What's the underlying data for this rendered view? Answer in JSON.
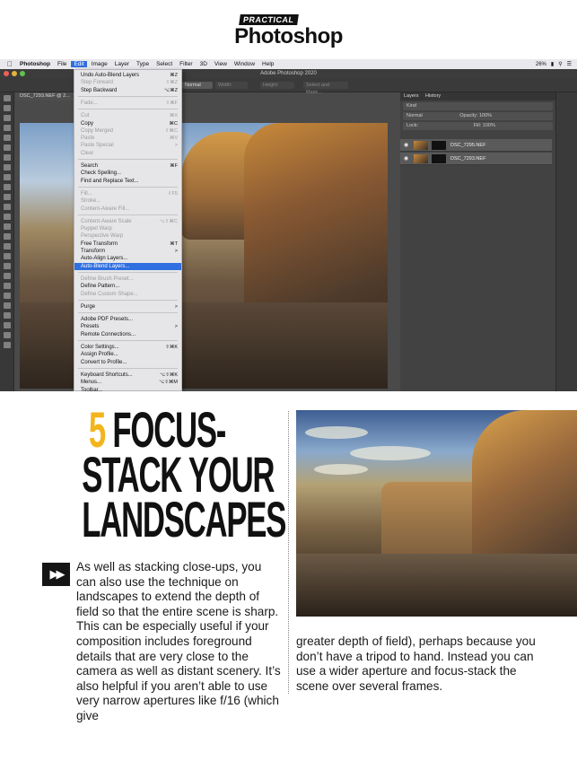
{
  "masthead": {
    "practical": "PRACTICAL",
    "photoshop": "Photoshop"
  },
  "screenshot": {
    "mac_menu": [
      "Photoshop",
      "File",
      "Edit",
      "Image",
      "Layer",
      "Type",
      "Select",
      "Filter",
      "3D",
      "View",
      "Window",
      "Help"
    ],
    "active_menu": "Edit",
    "battery": "26%",
    "window_title": "Adobe Photoshop 2020",
    "doc_tab": "DSC_7293.NEF @ 2...",
    "options": {
      "blend": "Normal",
      "width": "Width:",
      "height": "Height:",
      "select_mask": "Select and Mask..."
    },
    "edit_menu": [
      {
        "label": "Undo Auto-Blend Layers",
        "shortcut": "⌘Z",
        "disabled": false
      },
      {
        "label": "Step Forward",
        "shortcut": "⇧⌘Z",
        "disabled": true
      },
      {
        "label": "Step Backward",
        "shortcut": "⌥⌘Z",
        "disabled": false
      },
      {
        "label": "Fade...",
        "shortcut": "⇧⌘F",
        "disabled": true
      },
      {
        "label": "Cut",
        "shortcut": "⌘X",
        "disabled": true
      },
      {
        "label": "Copy",
        "shortcut": "⌘C",
        "disabled": false
      },
      {
        "label": "Copy Merged",
        "shortcut": "⇧⌘C",
        "disabled": true
      },
      {
        "label": "Paste",
        "shortcut": "⌘V",
        "disabled": true
      },
      {
        "label": "Paste Special",
        "shortcut": ">",
        "disabled": true
      },
      {
        "label": "Clear",
        "shortcut": "",
        "disabled": true
      },
      {
        "label": "Search",
        "shortcut": "⌘F",
        "disabled": false
      },
      {
        "label": "Check Spelling...",
        "shortcut": "",
        "disabled": false
      },
      {
        "label": "Find and Replace Text...",
        "shortcut": "",
        "disabled": false
      },
      {
        "label": "Fill...",
        "shortcut": "⇧F5",
        "disabled": true
      },
      {
        "label": "Stroke...",
        "shortcut": "",
        "disabled": true
      },
      {
        "label": "Content-Aware Fill...",
        "shortcut": "",
        "disabled": true
      },
      {
        "label": "Content-Aware Scale",
        "shortcut": "⌥⇧⌘C",
        "disabled": true
      },
      {
        "label": "Puppet Warp",
        "shortcut": "",
        "disabled": true
      },
      {
        "label": "Perspective Warp",
        "shortcut": "",
        "disabled": true
      },
      {
        "label": "Free Transform",
        "shortcut": "⌘T",
        "disabled": false
      },
      {
        "label": "Transform",
        "shortcut": ">",
        "disabled": false
      },
      {
        "label": "Auto-Align Layers...",
        "shortcut": "",
        "disabled": false
      },
      {
        "label": "Auto-Blend Layers...",
        "shortcut": "",
        "disabled": false,
        "highlighted": true
      },
      {
        "label": "Define Brush Preset...",
        "shortcut": "",
        "disabled": true
      },
      {
        "label": "Define Pattern...",
        "shortcut": "",
        "disabled": false
      },
      {
        "label": "Define Custom Shape...",
        "shortcut": "",
        "disabled": true
      },
      {
        "label": "Purge",
        "shortcut": ">",
        "disabled": false
      },
      {
        "label": "Adobe PDF Presets...",
        "shortcut": "",
        "disabled": false
      },
      {
        "label": "Presets",
        "shortcut": ">",
        "disabled": false
      },
      {
        "label": "Remote Connections...",
        "shortcut": "",
        "disabled": false
      },
      {
        "label": "Color Settings...",
        "shortcut": "⇧⌘K",
        "disabled": false
      },
      {
        "label": "Assign Profile...",
        "shortcut": "",
        "disabled": false
      },
      {
        "label": "Convert to Profile...",
        "shortcut": "",
        "disabled": false
      },
      {
        "label": "Keyboard Shortcuts...",
        "shortcut": "⌥⇧⌘K",
        "disabled": false
      },
      {
        "label": "Menus...",
        "shortcut": "⌥⇧⌘M",
        "disabled": false
      },
      {
        "label": "Toolbar...",
        "shortcut": "",
        "disabled": false
      }
    ],
    "layers_panel": {
      "tabs": [
        "Layers",
        "History"
      ],
      "kind": "Kind",
      "blend": "Normal",
      "opacity": "Opacity: 100%",
      "lock": "Lock:",
      "fill": "Fill: 100%",
      "layers": [
        "DSC_7295.NEF",
        "DSC_7293.NEF"
      ]
    }
  },
  "article": {
    "number": "5",
    "headline_line1": "FOCUS-",
    "headline_line2": "STACK YOUR",
    "headline_line3": "LANDSCAPES",
    "play_icon": "fast-forward-icon",
    "paragraph_col1": "As well as stacking close-ups, you can also use the technique on landscapes to extend the depth of field so that the entire scene is sharp. This can be especially useful if your composition includes foreground details that are very close to the camera as well as distant scenery. It’s also helpful if you aren’t able to use very narrow apertures like f/16 (which give",
    "paragraph_col2": "greater depth of field), perhaps because you don’t have a tripod to hand. Instead you can use a wider aperture and focus-stack the scene over several frames."
  },
  "colors": {
    "accent": "#f2b51c",
    "menu_highlight": "#2f6fe0"
  }
}
